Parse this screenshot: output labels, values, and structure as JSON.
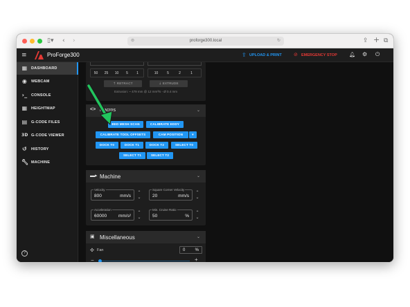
{
  "browser": {
    "url": "proforge300.local"
  },
  "app": {
    "title": "ProForge300",
    "upload_label": "UPLOAD & PRINT",
    "emergency_label": "EMERGENCY STOP",
    "brand_color": "#e53935",
    "accent_color": "#2196f3"
  },
  "sidebar": {
    "items": [
      {
        "label": "DASHBOARD",
        "icon": "dashboard-icon"
      },
      {
        "label": "WEBCAM",
        "icon": "webcam-icon"
      },
      {
        "label": "CONSOLE",
        "icon": "console-icon"
      },
      {
        "label": "HEIGHTMAP",
        "icon": "grid-icon"
      },
      {
        "label": "G-CODE FILES",
        "icon": "files-icon"
      },
      {
        "label": "G-CODE VIEWER",
        "icon": "3d-icon"
      },
      {
        "label": "HISTORY",
        "icon": "history-icon"
      },
      {
        "label": "MACHINE",
        "icon": "wrench-icon"
      }
    ]
  },
  "extruder": {
    "step_values_left": [
      "50",
      "25",
      "10",
      "5",
      "1"
    ],
    "step_values_right": [
      "10",
      "5",
      "2",
      "1"
    ],
    "retract_label": "RETRACT",
    "extrude_label": "EXTRUDE",
    "info": "Extrusion: ~ 479 mm @ 12 mm³/s - Ø 0.4 mm"
  },
  "macros": {
    "title": "Macros",
    "buttons": {
      "bed_mesh": "BED MESH SCAN",
      "calibrate_eddy": "CALIBRATE EDDY",
      "calibrate_tool": "CALIBRATE TOOL OFFSETS",
      "cam_position": "CAM POSITION",
      "dock_t0": "DOCK T0",
      "dock_t1": "DOCK T1",
      "dock_t2": "DOCK T2",
      "select_t0": "SELECT T0",
      "select_t1": "SELECT T1",
      "select_t2": "SELECT T2"
    }
  },
  "machine": {
    "title": "Machine",
    "velocity": {
      "label": "Velocity",
      "value": "800",
      "unit": "mm/s"
    },
    "scv": {
      "label": "Square Corner Velocity",
      "value": "20",
      "unit": "mm/s"
    },
    "accel": {
      "label": "Acceleration",
      "value": "60000",
      "unit": "mm/s²"
    },
    "cruise": {
      "label": "Min. Cruise Ratio",
      "value": "50",
      "unit": "%"
    }
  },
  "misc": {
    "title": "Miscellaneous",
    "fan_label": "Fan",
    "fan_value": "0",
    "fan_unit": "%",
    "fan_level_percent": 0
  }
}
